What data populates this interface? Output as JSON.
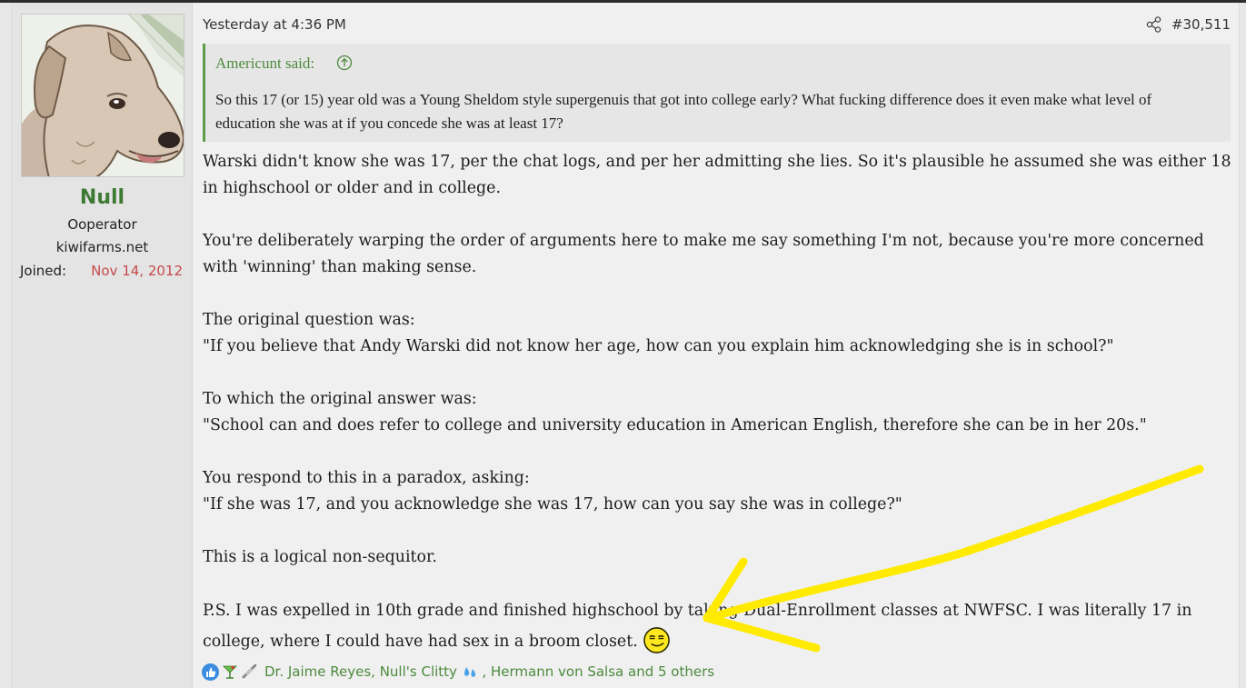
{
  "user": {
    "name": "Null",
    "title": "Ooperator",
    "site": "kiwifarms.net",
    "joined_label": "Joined:",
    "joined_date": "Nov 14, 2012",
    "avatar_icon": "dog-avatar"
  },
  "post": {
    "timestamp": "Yesterday at 4:36 PM",
    "number": "#30,511",
    "share_icon": "share-icon"
  },
  "quote": {
    "author": "Americunt said:",
    "jump_icon": "arrow-up-circle-icon",
    "text": "So this 17 (or 15) year old was a Young Sheldom style supergenuis that got into college early? What fucking difference does it even make what level of education she was at if you concede she was at least 17?"
  },
  "body": {
    "p1": "Warski didn't know she was 17, per the chat logs, and per her admitting she lies. So it's plausible he assumed she was either 18 in highschool or older and in college.",
    "p2": "You're deliberately warping the order of arguments here to make me say something I'm not, because you're more concerned with 'winning' than making sense.",
    "p3_line1": "The original question was:",
    "p3_line2": "\"If you believe that Andy Warski did not know her age, how can you explain him acknowledging she is in school?\"",
    "p4_line1": "To which the original answer was:",
    "p4_line2": "\"School can and does refer to college and university education in American English, therefore she can be in her 20s.\"",
    "p5_line1": "You respond to this in a paradox, asking:",
    "p5_line2": "\"If she was 17, and you acknowledge she was 17, how can you say she was in college?\"",
    "p6": "This is a logical non-sequitor.",
    "p7": "P.S. I was expelled in 10th grade and finished highschool by taking Dual-Enrollment classes at NWFSC. I was literally 17 in college, where I could have had sex in a broom closet.",
    "smiley_icon": "smug-smiley-icon"
  },
  "reactions": {
    "icons": [
      "like-icon",
      "cocktail-icon",
      "syringe-icon"
    ],
    "names_part1": "Dr. Jaime Reyes, Null's Clitty",
    "names_part2": ", Hermann von Salsa and 5 others",
    "drop_icon": "water-drops-icon"
  },
  "annotation": {
    "color": "#ffea00",
    "shape": "hand-drawn arrow"
  }
}
